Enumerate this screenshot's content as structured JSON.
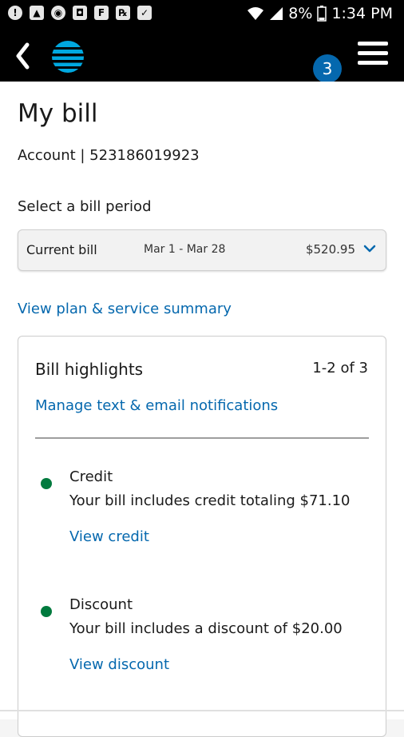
{
  "status_bar": {
    "battery_percent": "8%",
    "time": "1:34 PM",
    "left_icons": [
      "alert-icon",
      "image-icon",
      "shield-wifi-icon",
      "camera-icon",
      "flipboard-icon",
      "prescription-icon",
      "clipboard-check-icon"
    ]
  },
  "header": {
    "notification_count": "3",
    "brand_color": "#00a8e0"
  },
  "page": {
    "title": "My bill",
    "account_text": "Account | 523186019923",
    "period_label": "Select a bill period"
  },
  "bill_period": {
    "name": "Current bill",
    "dates": "Mar 1 - Mar 28",
    "amount": "$520.95"
  },
  "links": {
    "plan_summary": "View plan & service summary"
  },
  "highlights": {
    "title": "Bill highlights",
    "count": "1-2 of 3",
    "manage_link": "Manage text & email notifications",
    "items": [
      {
        "title": "Credit",
        "description": "Your bill includes credit totaling $71.10",
        "action": "View credit",
        "dot_color": "#007a3e"
      },
      {
        "title": "Discount",
        "description": "Your bill includes a discount of $20.00",
        "action": "View discount",
        "dot_color": "#007a3e"
      }
    ]
  },
  "colors": {
    "link": "#0568ae",
    "header_bg": "#000000",
    "badge_bg": "#0568ae"
  }
}
